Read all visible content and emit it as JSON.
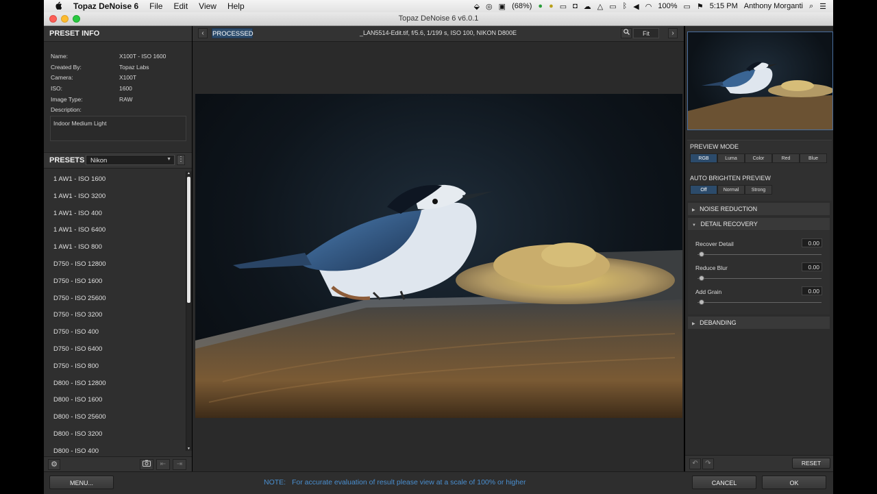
{
  "menubar": {
    "apple": "",
    "app_name": "Topaz DeNoise 6",
    "items": [
      "File",
      "Edit",
      "View",
      "Help"
    ],
    "battery_pct_small": "(68%)",
    "battery": "100%",
    "time": "5:15 PM",
    "user": "Anthony Morganti"
  },
  "window": {
    "title": "Topaz DeNoise 6 v6.0.1"
  },
  "preset_info": {
    "header": "PRESET INFO",
    "rows": [
      {
        "label": "Name:",
        "value": "X100T - ISO 1600"
      },
      {
        "label": "Created By:",
        "value": "Topaz Labs"
      },
      {
        "label": "Camera:",
        "value": "X100T"
      },
      {
        "label": "ISO:",
        "value": "1600"
      },
      {
        "label": "Image Type:",
        "value": "RAW"
      },
      {
        "label": "Description:",
        "value": ""
      }
    ],
    "description": "Indoor Medium Light"
  },
  "presets": {
    "header": "PRESETS",
    "selected_camera": "Nikon",
    "items": [
      "1 AW1 - ISO 1600",
      "1 AW1 - ISO 3200",
      "1 AW1 - ISO 400",
      "1 AW1 - ISO 6400",
      "1 AW1 - ISO 800",
      "D750 - ISO 12800",
      "D750 - ISO 1600",
      "D750 - ISO 25600",
      "D750 - ISO 3200",
      "D750 - ISO 400",
      "D750 - ISO 6400",
      "D750 - ISO 800",
      "D800 - ISO 12800",
      "D800 - ISO 1600",
      "D800 - ISO 25600",
      "D800 - ISO 3200",
      "D800 - ISO 400"
    ]
  },
  "toolbar": {
    "processed_label": "PROCESSED",
    "file_info": "_LAN5514-Edit.tif, f/5.6, 1/199 s, ISO 100, NIKON D800E",
    "zoom_label": "Fit"
  },
  "preview_mode": {
    "label": "PREVIEW MODE",
    "options": [
      "RGB",
      "Luma",
      "Color",
      "Red",
      "Blue"
    ],
    "selected": "RGB"
  },
  "auto_brighten": {
    "label": "AUTO BRIGHTEN PREVIEW",
    "options": [
      "Off",
      "Normal",
      "Strong"
    ],
    "selected": "Off"
  },
  "sections": {
    "noise_reduction": "NOISE REDUCTION",
    "detail_recovery": "DETAIL RECOVERY",
    "debanding": "DEBANDING"
  },
  "sliders": [
    {
      "label": "Recover Detail",
      "value": "0.00"
    },
    {
      "label": "Reduce Blur",
      "value": "0.00"
    },
    {
      "label": "Add Grain",
      "value": "0.00"
    }
  ],
  "bottom": {
    "menu_label": "MENU...",
    "note_prefix": "NOTE:",
    "note": "For accurate evaluation of result please view at a scale of 100% or higher",
    "reset_label": "RESET",
    "cancel_label": "CANCEL",
    "ok_label": "OK"
  },
  "colors": {
    "accent": "#2c4b6b",
    "note_text": "#4a8fd0",
    "panel_bg": "#2f2f2f"
  }
}
